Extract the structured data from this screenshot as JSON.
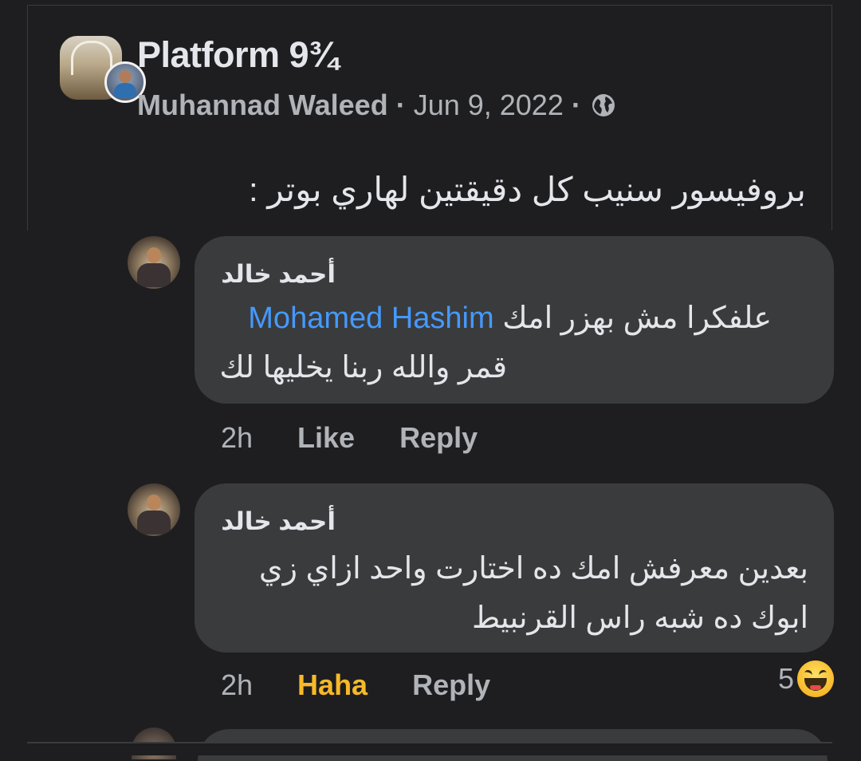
{
  "post": {
    "group_name": "Platform 9¾",
    "author": "Muhannad Waleed",
    "separator": "·",
    "date": "Jun 9, 2022",
    "privacy_icon": "globe-icon",
    "text": "بروفيسور سنيب كل دقيقتين لهاري بوتر :"
  },
  "comments": [
    {
      "author": "أحمد خالد",
      "line1_text": "علفكرا مش بهزر امك",
      "line1_mention": "Mohamed Hashim",
      "line2": "قمر والله ربنا يخليها لك",
      "time": "2h",
      "like_label": "Like",
      "reply_label": "Reply"
    },
    {
      "author": "أحمد خالد",
      "line1": "بعدين معرفش امك ده اختارت واحد ازاي زي",
      "line2": "ابوك ده شبه راس القرنبيط",
      "time": "2h",
      "reaction_label": "Haha",
      "reply_label": "Reply",
      "reaction_count": "5",
      "reaction_icon": "haha-icon"
    }
  ],
  "colors": {
    "background": "#1e1e20",
    "bubble": "#3a3b3c",
    "mention": "#4599ff",
    "haha": "#f7b928",
    "muted": "#b0b3b8"
  }
}
